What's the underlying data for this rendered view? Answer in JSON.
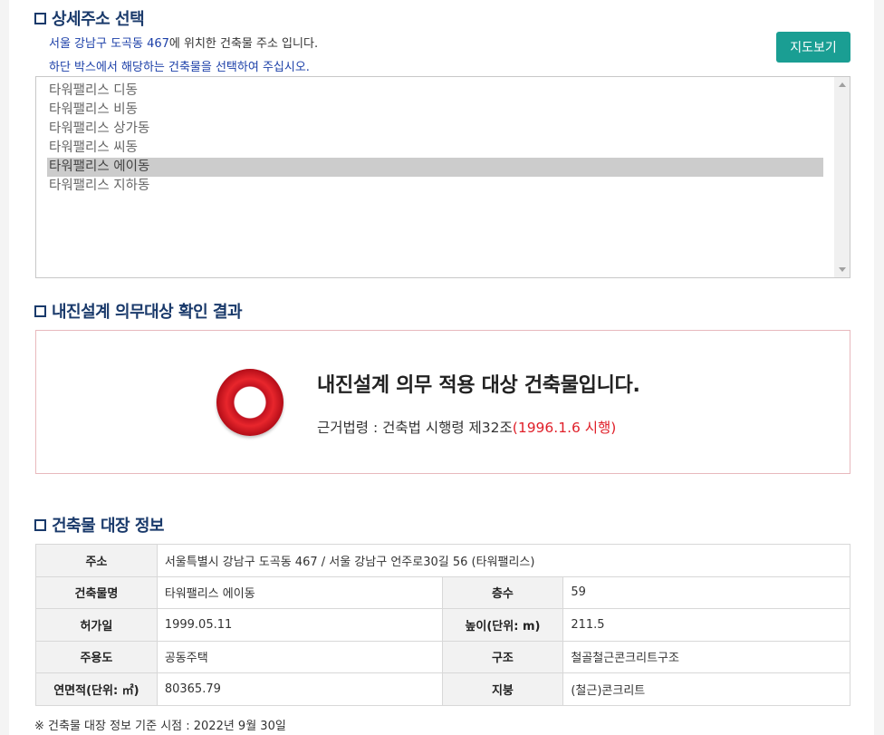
{
  "detail_address": {
    "title": "상세주소 선택",
    "address_text": "서울 강남구 도곡동 467",
    "address_suffix": "에 위치한 건축물 주소 입니다.",
    "instruction": "하단 박스에서 해당하는 건축물을 선택하여 주십시오.",
    "map_button": "지도보기",
    "buildings": [
      {
        "label": "타워팰리스 디동",
        "selected": false
      },
      {
        "label": "타워팰리스 비동",
        "selected": false
      },
      {
        "label": "타워팰리스 상가동",
        "selected": false
      },
      {
        "label": "타워팰리스 씨동",
        "selected": false
      },
      {
        "label": "타워팰리스 에이동",
        "selected": true
      },
      {
        "label": "타워팰리스 지하동",
        "selected": false
      }
    ]
  },
  "seismic_result": {
    "title": "내진설계 의무대상 확인 결과",
    "icon": "o-mark-icon",
    "message": "내진설계 의무 적용 대상 건축물입니다.",
    "basis_prefix": "근거법령 : 건축법 시행령 제32조",
    "basis_date": "(1996.1.6 시행)"
  },
  "registry": {
    "title": "건축물 대장 정보",
    "address_label": "주소",
    "address_value": "서울특별시 강남구 도곡동 467 / 서울 강남구 언주로30길 56 (타워팰리스)",
    "rows": [
      {
        "label1": "건축물명",
        "value1": "타워팰리스 에이동",
        "label2": "층수",
        "value2": "59"
      },
      {
        "label1": "허가일",
        "value1": "1999.05.11",
        "label2": "높이(단위: m)",
        "value2": "211.5"
      },
      {
        "label1": "주용도",
        "value1": "공동주택",
        "label2": "구조",
        "value2": "철골철근콘크리트구조"
      },
      {
        "label1": "연면적(단위: ㎡)",
        "value1": "80365.79",
        "label2": "지붕",
        "value2": "(철근)콘크리트"
      }
    ],
    "footnote": "※ 건축물 대장 정보 기준 시점 : 2022년 9월 30일"
  },
  "colors": {
    "title_navy": "#1a3a6b",
    "address_blue": "#1b3fa8",
    "button_teal": "#1a9e93",
    "alert_red": "#e0202a",
    "result_border": "#e8b9bd",
    "selected_row": "#cccccc"
  }
}
